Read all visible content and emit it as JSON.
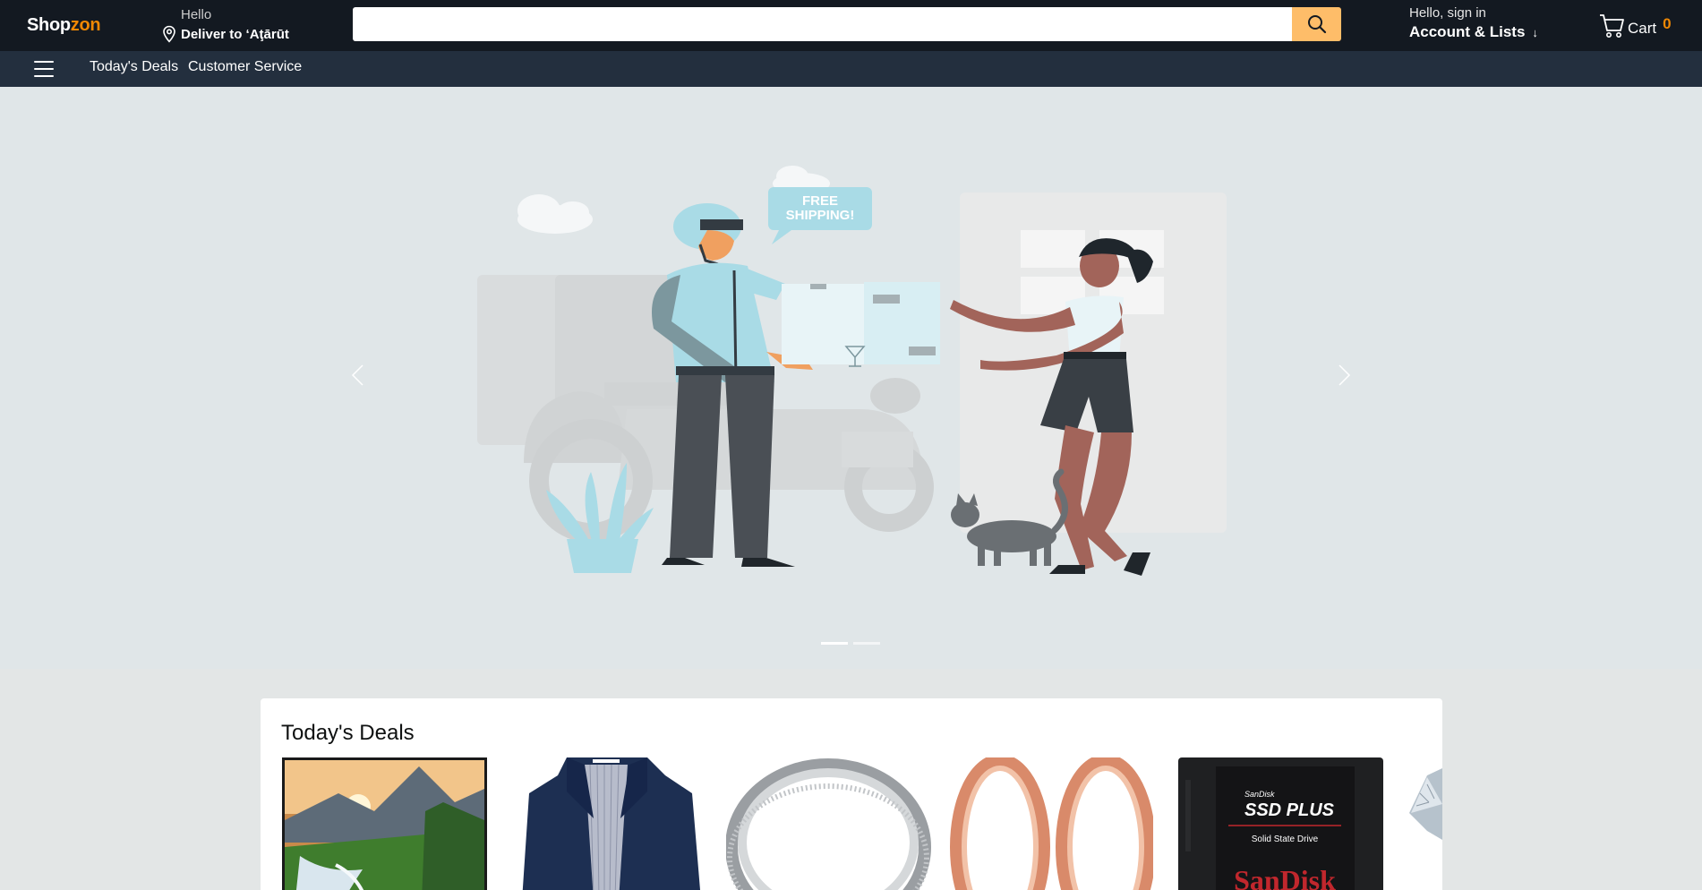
{
  "header": {
    "logo_main": "Shop",
    "logo_accent": "zon",
    "deliver_hello": "Hello",
    "deliver_to": "Deliver to ‘Aţārūt",
    "search_placeholder": "",
    "account_line1": "Hello, sign in",
    "account_line2": "Account & Lists",
    "account_arrow": "↓",
    "cart_label": "Cart",
    "cart_count": "0"
  },
  "nav": {
    "links": [
      "Today's Deals",
      "Customer Service"
    ]
  },
  "hero": {
    "speech_bubble_line1": "FREE",
    "speech_bubble_line2": "SHIPPING!",
    "slides_count": 2,
    "active_slide": 1
  },
  "deals": {
    "title": "Today's Deals",
    "products": [
      {
        "image": "waterfall-landscape-tv"
      },
      {
        "image": "navy-jacket"
      },
      {
        "image": "silver-ring"
      },
      {
        "image": "rose-gold-rings"
      },
      {
        "image": "sandisk-ssd"
      },
      {
        "image": "diamond-ring"
      }
    ],
    "ssd_brand_small": "SanDisk",
    "ssd_title": "SSD PLUS",
    "ssd_subtitle": "Solid State Drive",
    "ssd_brand_big": "SanDisk"
  },
  "colors": {
    "header_bg": "#131921",
    "subnav_bg": "#232f3e",
    "accent": "#f08804",
    "search_button": "#febd69",
    "hero_bg": "#e0e6e8"
  }
}
